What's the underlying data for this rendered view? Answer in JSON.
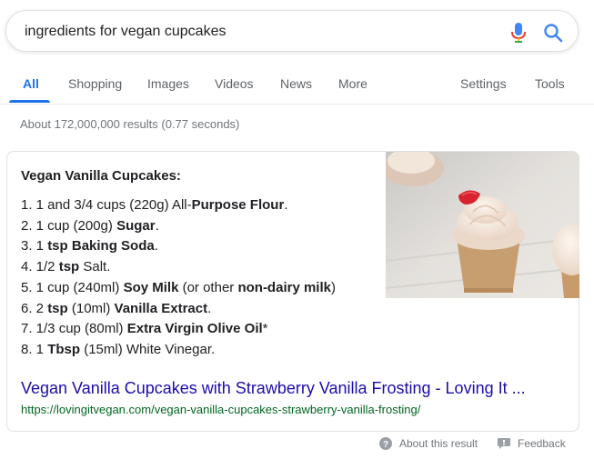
{
  "search": {
    "query": "ingredients for vegan cupcakes",
    "mic_icon": "mic-icon",
    "search_icon": "search-icon"
  },
  "tabs": {
    "all": "All",
    "shopping": "Shopping",
    "images": "Images",
    "videos": "Videos",
    "news": "News",
    "more": "More",
    "settings": "Settings",
    "tools": "Tools"
  },
  "stats": "About 172,000,000 results (0.77 seconds)",
  "snippet": {
    "title": "Vegan Vanilla Cupcakes:",
    "items": [
      [
        {
          "t": "1. 1 and 3/4 cups (220g) All-"
        },
        {
          "t": "Purpose Flour",
          "b": true
        },
        {
          "t": "."
        }
      ],
      [
        {
          "t": "2. 1 cup (200g) "
        },
        {
          "t": "Sugar",
          "b": true
        },
        {
          "t": "."
        }
      ],
      [
        {
          "t": "3. 1 "
        },
        {
          "t": "tsp Baking Soda",
          "b": true
        },
        {
          "t": "."
        }
      ],
      [
        {
          "t": "4. 1/2 "
        },
        {
          "t": "tsp",
          "b": true
        },
        {
          "t": " Salt."
        }
      ],
      [
        {
          "t": "5. 1 cup (240ml) "
        },
        {
          "t": "Soy Milk",
          "b": true
        },
        {
          "t": " (or other "
        },
        {
          "t": "non-dairy milk",
          "b": true
        },
        {
          "t": ")"
        }
      ],
      [
        {
          "t": "6. 2 "
        },
        {
          "t": "tsp",
          "b": true
        },
        {
          "t": " (10ml) "
        },
        {
          "t": "Vanilla Extract",
          "b": true
        },
        {
          "t": "."
        }
      ],
      [
        {
          "t": "7. 1/3 cup (80ml) "
        },
        {
          "t": "Extra Virgin Olive Oil",
          "b": true
        },
        {
          "t": "*"
        }
      ],
      [
        {
          "t": "8. 1 "
        },
        {
          "t": "Tbsp",
          "b": true
        },
        {
          "t": " (15ml) White Vinegar."
        }
      ]
    ],
    "image_alt": "vanilla-cupcakes-photo"
  },
  "result": {
    "title": "Vegan Vanilla Cupcakes with Strawberry Vanilla Frosting - Loving It ...",
    "url": "https://lovingitvegan.com/vegan-vanilla-cupcakes-strawberry-vanilla-frosting/"
  },
  "footer": {
    "about": "About this result",
    "feedback": "Feedback"
  },
  "colors": {
    "accent": "#1a73e8",
    "link": "#1a0dab",
    "url": "#006621"
  }
}
